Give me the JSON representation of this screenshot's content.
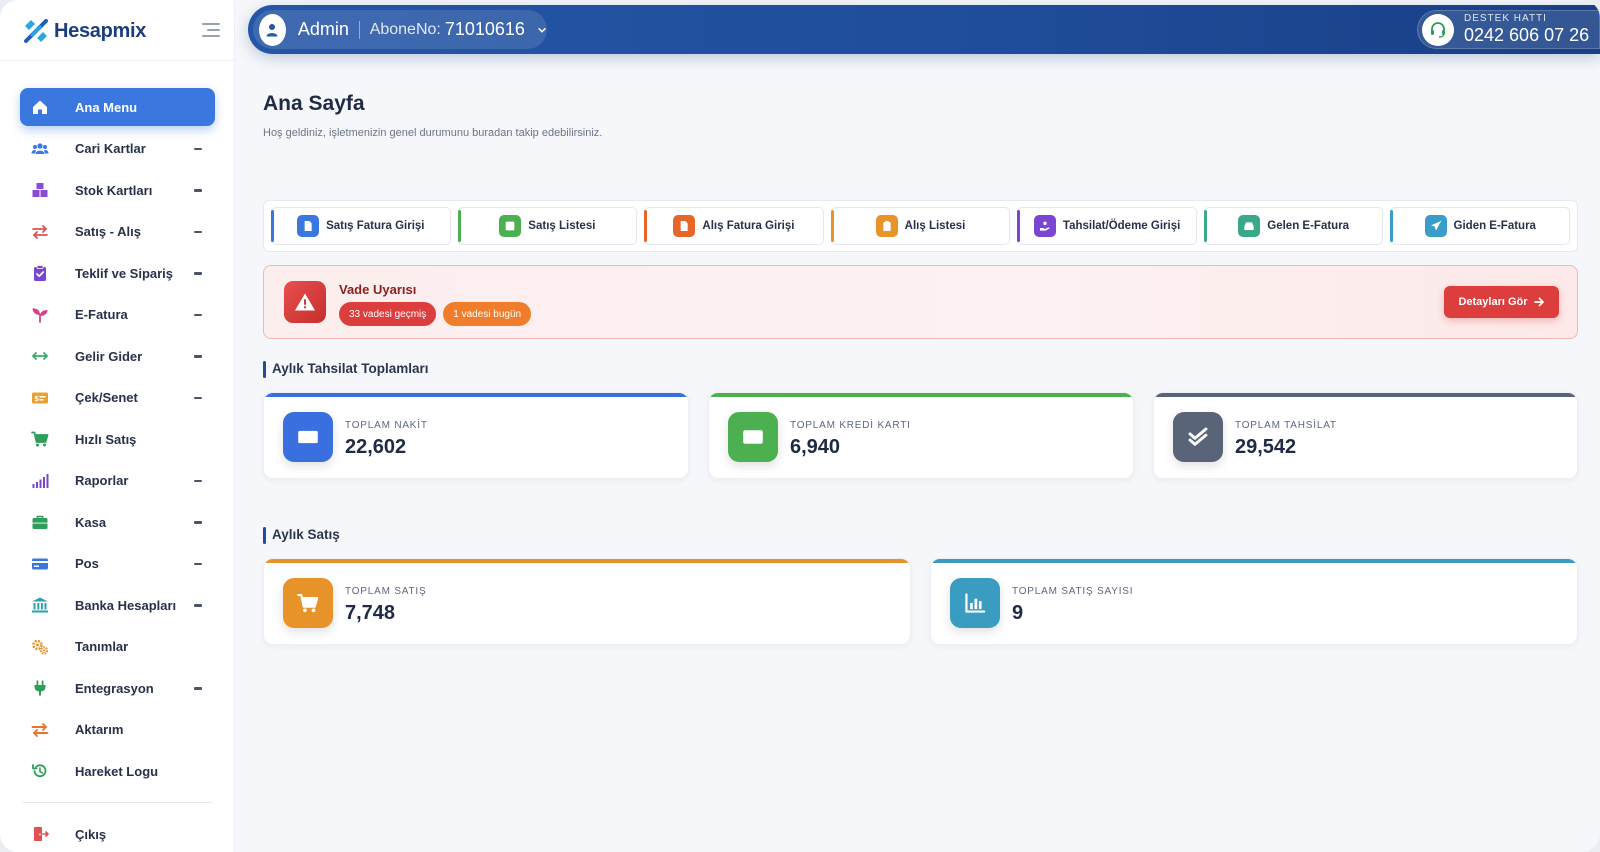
{
  "brand": {
    "name": "Hesapmix"
  },
  "sidebar": {
    "items": [
      {
        "label": "Ana Menu",
        "icon": "home-icon",
        "color": "#ffffff",
        "active": true,
        "expandable": false
      },
      {
        "label": "Cari Kartlar",
        "icon": "users-icon",
        "color": "#3a78e0",
        "active": false,
        "expandable": true
      },
      {
        "label": "Stok Kartları",
        "icon": "boxes-icon",
        "color": "#8b4bd6",
        "active": false,
        "expandable": true
      },
      {
        "label": "Satış - Alış",
        "icon": "exchange-icon",
        "color": "#e05252",
        "active": false,
        "expandable": true
      },
      {
        "label": "Teklif ve Sipariş",
        "icon": "clipboard-check-icon",
        "color": "#7a45d0",
        "active": false,
        "expandable": true
      },
      {
        "label": "E-Fatura",
        "icon": "seedling-icon",
        "color": "#d9408a",
        "active": false,
        "expandable": true
      },
      {
        "label": "Gelir Gider",
        "icon": "arrows-horizontal-icon",
        "color": "#3aa86a",
        "active": false,
        "expandable": true
      },
      {
        "label": "Çek/Senet",
        "icon": "money-check-icon",
        "color": "#e8a030",
        "active": false,
        "expandable": true
      },
      {
        "label": "Hızlı Satış",
        "icon": "cart-icon",
        "color": "#2e9e5a",
        "active": false,
        "expandable": false
      },
      {
        "label": "Raporlar",
        "icon": "signal-bars-icon",
        "color": "#7a45d0",
        "active": false,
        "expandable": true
      },
      {
        "label": "Kasa",
        "icon": "briefcase-icon",
        "color": "#2e9e5a",
        "active": false,
        "expandable": true
      },
      {
        "label": "Pos",
        "icon": "credit-card-icon",
        "color": "#3a78e0",
        "active": false,
        "expandable": true
      },
      {
        "label": "Banka Hesapları",
        "icon": "bank-icon",
        "color": "#2aa0b0",
        "active": false,
        "expandable": true
      },
      {
        "label": "Tanımlar",
        "icon": "gears-icon",
        "color": "#e8942a",
        "active": false,
        "expandable": false
      },
      {
        "label": "Entegrasyon",
        "icon": "plug-icon",
        "color": "#2e9e5a",
        "active": false,
        "expandable": true
      },
      {
        "label": "Aktarım",
        "icon": "transfer-icon",
        "color": "#e8742a",
        "active": false,
        "expandable": false
      },
      {
        "label": "Hareket Logu",
        "icon": "history-icon",
        "color": "#2e9e5a",
        "active": false,
        "expandable": false
      }
    ],
    "logout": {
      "label": "Çıkış",
      "icon": "door-exit-icon",
      "color": "#e05252"
    }
  },
  "topbar": {
    "user_name": "Admin",
    "abone_label": "AboneNo:",
    "abone_no": "71010616",
    "support_label": "DESTEK HATTI",
    "support_phone": "0242 606 07 26"
  },
  "page": {
    "title": "Ana Sayfa",
    "subtitle": "Hoş geldiniz, işletmenizin genel durumunu buradan takip edebilirsiniz."
  },
  "quick_actions": [
    {
      "label": "Satış Fatura Girişi",
      "icon": "file-invoice-icon",
      "color": "#3a78e0"
    },
    {
      "label": "Satış Listesi",
      "icon": "list-icon",
      "color": "#4caf50"
    },
    {
      "label": "Alış Fatura Girişi",
      "icon": "file-invoice-icon",
      "color": "#e8652a"
    },
    {
      "label": "Alış Listesi",
      "icon": "clipboard-icon",
      "color": "#e8942a"
    },
    {
      "label": "Tahsilat/Ödeme Girişi",
      "icon": "hand-coin-icon",
      "color": "#7a45d0"
    },
    {
      "label": "Gelen E-Fatura",
      "icon": "inbox-icon",
      "color": "#3aa88a"
    },
    {
      "label": "Giden E-Fatura",
      "icon": "paper-plane-icon",
      "color": "#3a9cc8"
    }
  ],
  "alert": {
    "title": "Vade Uyarısı",
    "badge_overdue": "33 vadesi geçmiş",
    "badge_today": "1 vadesi bugün",
    "button_label": "Detayları Gör"
  },
  "monthly_collections": {
    "title": "Aylık Tahsilat Toplamları",
    "cards": [
      {
        "label": "TOPLAM NAKİT",
        "value": "22,602",
        "icon": "cash-icon",
        "color": "#3a6fe0"
      },
      {
        "label": "TOPLAM KREDİ KARTI",
        "value": "6,940",
        "icon": "credit-card-icon",
        "color": "#4caf50"
      },
      {
        "label": "TOPLAM TAHSİLAT",
        "value": "29,542",
        "icon": "double-check-icon",
        "color": "#5a6478"
      }
    ]
  },
  "monthly_sales": {
    "title": "Aylık Satış",
    "cards": [
      {
        "label": "TOPLAM SATIŞ",
        "value": "7,748",
        "icon": "cart-icon",
        "color": "#e8922a"
      },
      {
        "label": "TOPLAM SATIŞ SAYISI",
        "value": "9",
        "icon": "bar-chart-icon",
        "color": "#3a9cc0"
      }
    ]
  }
}
